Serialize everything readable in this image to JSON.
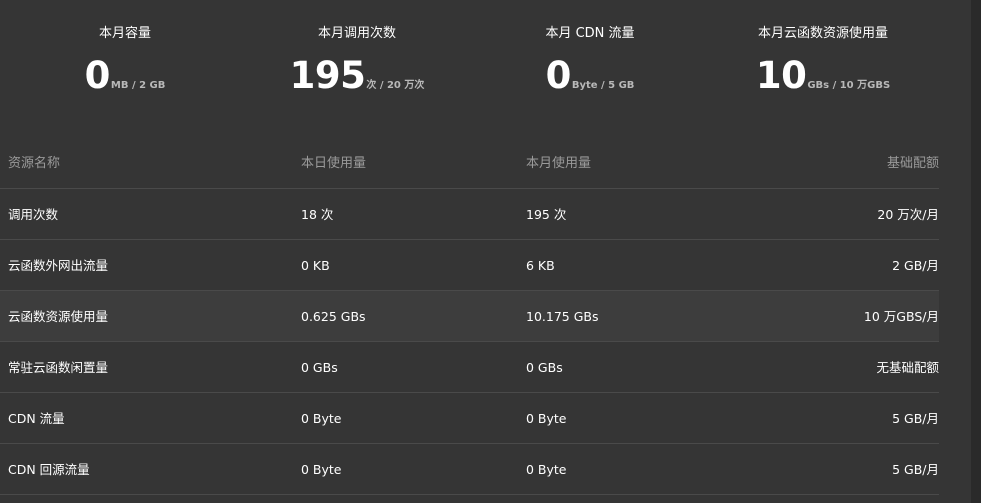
{
  "stats": [
    {
      "label": "本月容量",
      "value": "0",
      "unit": "MB / 2 GB"
    },
    {
      "label": "本月调用次数",
      "value": "195",
      "unit": "次 / 20 万次"
    },
    {
      "label": "本月 CDN 流量",
      "value": "0",
      "unit": "Byte / 5 GB"
    },
    {
      "label": "本月云函数资源使用量",
      "value": "10",
      "unit": "GBs / 10 万GBS"
    }
  ],
  "table": {
    "headers": [
      "资源名称",
      "本日使用量",
      "本月使用量",
      "基础配额"
    ],
    "rows": [
      [
        "调用次数",
        "18 次",
        "195 次",
        "20 万次/月"
      ],
      [
        "云函数外网出流量",
        "0 KB",
        "6 KB",
        "2 GB/月"
      ],
      [
        "云函数资源使用量",
        "0.625 GBs",
        "10.175 GBs",
        "10 万GBS/月"
      ],
      [
        "常驻云函数闲置量",
        "0 GBs",
        "0 GBs",
        "无基础配额"
      ],
      [
        "CDN 流量",
        "0 Byte",
        "0 Byte",
        "5 GB/月"
      ],
      [
        "CDN 回源流量",
        "0 Byte",
        "0 Byte",
        "5 GB/月"
      ]
    ]
  },
  "colors": {
    "background": "#353535",
    "row_highlight": "#3d3d3d",
    "divider": "#4a4a4a",
    "header_text": "#9a9a9a",
    "unit_text": "#b8b8b8"
  }
}
